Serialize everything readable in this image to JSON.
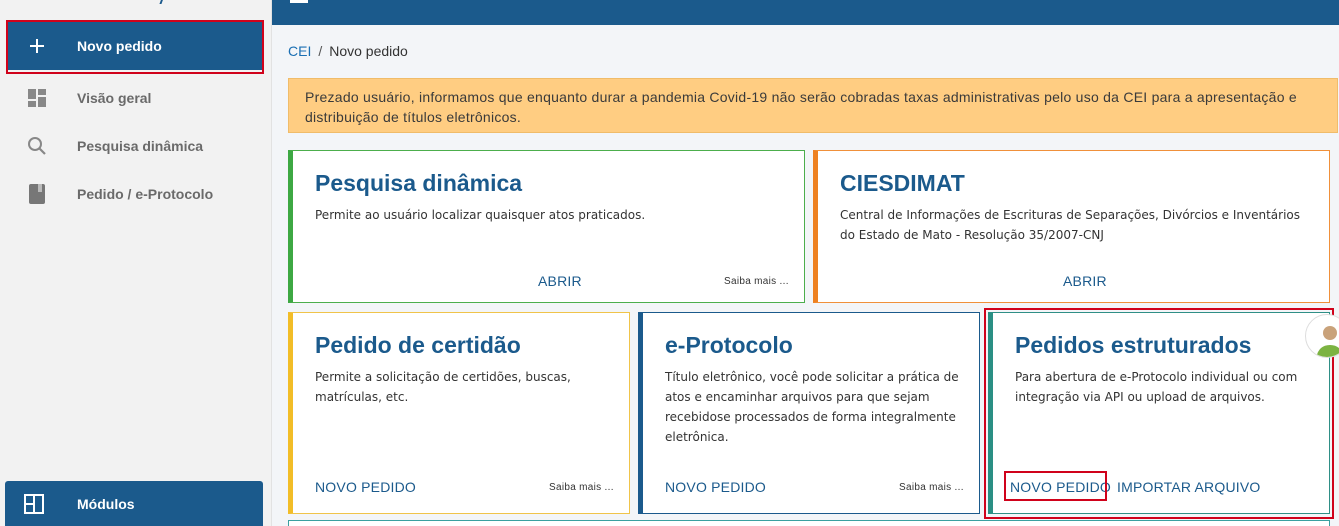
{
  "sidebar": {
    "items": [
      {
        "label": "Novo pedido",
        "icon": "plus-icon"
      },
      {
        "label": "Visão geral",
        "icon": "dashboard-icon"
      },
      {
        "label": "Pesquisa dinâmica",
        "icon": "search-icon"
      },
      {
        "label": "Pedido / e-Protocolo",
        "icon": "book-icon"
      }
    ],
    "modules": {
      "label": "Módulos",
      "icon": "modules-icon"
    }
  },
  "breadcrumb": {
    "root": "CEI",
    "separator": "/",
    "current": "Novo pedido"
  },
  "alert": {
    "text": "Prezado usuário, informamos que enquanto durar a pandemia Covid-19 não serão cobradas taxas administrativas pelo uso da CEI para a apresentação e distribuição de títulos eletrônicos."
  },
  "cards": {
    "pesquisa": {
      "title": "Pesquisa dinâmica",
      "description": "Permite ao usuário localizar quaisquer atos praticados.",
      "button": "ABRIR",
      "more": "Saiba mais ..."
    },
    "ciesdimat": {
      "title": "CIESDIMAT",
      "description": "Central de Informações de Escrituras de Separações, Divórcios e Inventários do Estado de Mato - Resolução 35/2007-CNJ",
      "button": "ABRIR"
    },
    "certidao": {
      "title": "Pedido de certidão",
      "description": "Permite a solicitação de certidões, buscas, matrículas, etc.",
      "button": "NOVO PEDIDO",
      "more": "Saiba mais ..."
    },
    "eprotocolo": {
      "title": "e-Protocolo",
      "description": "Título eletrônico, você pode solicitar a prática de atos e encaminhar arquivos para que sejam recebidose processados de forma integralmente eletrônica.",
      "button": "NOVO PEDIDO",
      "more": "Saiba mais ..."
    },
    "estruturados": {
      "title": "Pedidos estruturados",
      "description": "Para abertura de e-Protocolo individual ou com integração via API ou upload de arquivos.",
      "button": "NOVO PEDIDO",
      "button2": "IMPORTAR ARQUIVO"
    }
  },
  "colors": {
    "primary": "#1b5a8c",
    "highlight": "#d0021b",
    "alert_bg": "#ffcd82",
    "green": "#3da843",
    "orange": "#ee8121",
    "yellow": "#f2bd28",
    "teal": "#2a8f84"
  }
}
